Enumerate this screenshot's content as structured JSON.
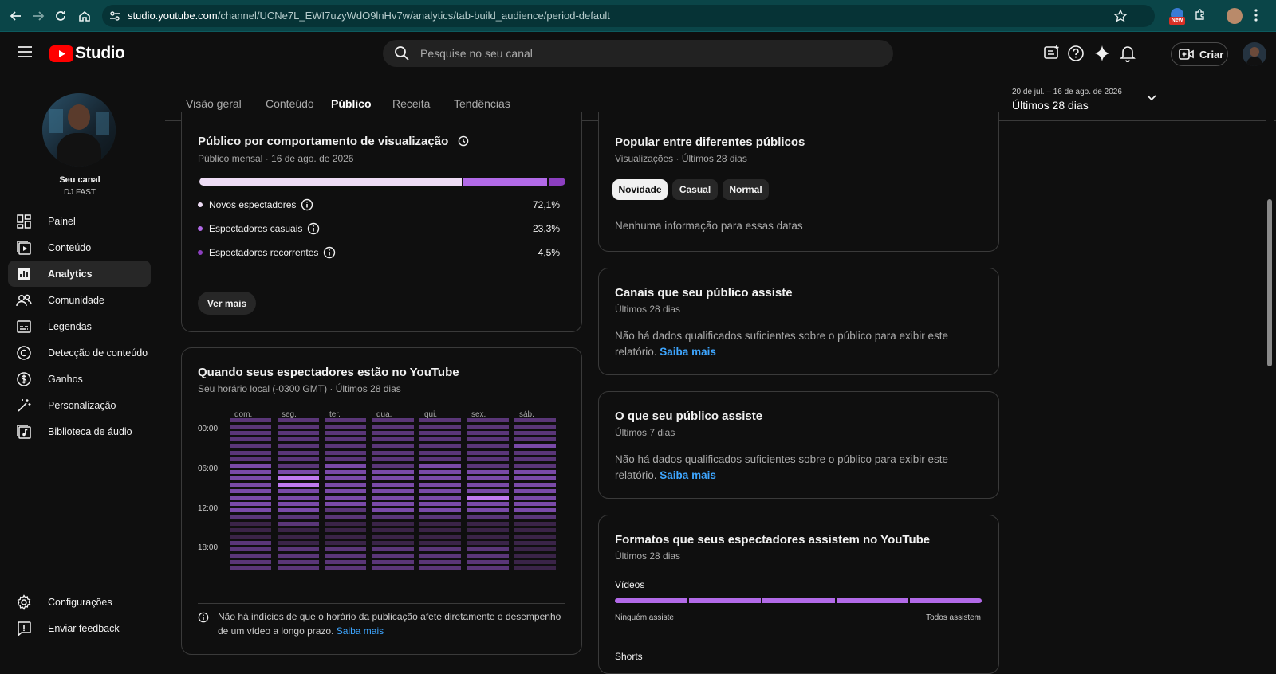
{
  "browser": {
    "url_host": "studio.youtube.com",
    "url_path": "/channel/UCNe7L_EWI7uzyWdO9lnHv7w/analytics/tab-build_audience/period-default",
    "ext_badge": "New"
  },
  "header": {
    "app_name": "Studio",
    "search_placeholder": "Pesquise no seu canal",
    "create_label": "Criar"
  },
  "sidebar": {
    "channel_label": "Seu canal",
    "channel_name": "DJ FAST",
    "items": [
      {
        "label": "Painel",
        "icon": "dashboard-icon"
      },
      {
        "label": "Conteúdo",
        "icon": "content-icon"
      },
      {
        "label": "Analytics",
        "icon": "analytics-icon",
        "active": true
      },
      {
        "label": "Comunidade",
        "icon": "community-icon"
      },
      {
        "label": "Legendas",
        "icon": "subtitles-icon"
      },
      {
        "label": "Detecção de conteúdo",
        "icon": "copyright-icon"
      },
      {
        "label": "Ganhos",
        "icon": "earn-icon"
      },
      {
        "label": "Personalização",
        "icon": "customization-icon"
      },
      {
        "label": "Biblioteca de áudio",
        "icon": "audio-library-icon"
      }
    ],
    "bottom_items": [
      {
        "label": "Configurações",
        "icon": "settings-icon"
      },
      {
        "label": "Enviar feedback",
        "icon": "feedback-icon"
      }
    ]
  },
  "tabs": [
    {
      "label": "Visão geral"
    },
    {
      "label": "Conteúdo"
    },
    {
      "label": "Público",
      "active": true
    },
    {
      "label": "Receita"
    },
    {
      "label": "Tendências"
    }
  ],
  "period": {
    "range": "20 de jul. – 16 de ago. de 2026",
    "label": "Últimos 28 dias"
  },
  "behavior_card": {
    "title": "Público por comportamento de visualização",
    "subtitle": "Público mensal · 16 de ago. de 2026",
    "segments": [
      {
        "label": "Novos espectadores",
        "value": "72,1%",
        "share": 72.1,
        "color": "#eedcf5"
      },
      {
        "label": "Espectadores casuais",
        "value": "23,3%",
        "share": 23.3,
        "color": "#b26ae8"
      },
      {
        "label": "Espectadores recorrentes",
        "value": "4,5%",
        "share": 4.5,
        "color": "#8c3fc0"
      }
    ],
    "more_button": "Ver mais"
  },
  "when_card": {
    "title": "Quando seus espectadores estão no YouTube",
    "subtitle": "Seu horário local (-0300 GMT) · Últimos 28 dias",
    "days": [
      "dom.",
      "seg.",
      "ter.",
      "qua.",
      "qui.",
      "sex.",
      "sáb."
    ],
    "hours": [
      "00:00",
      "06:00",
      "12:00",
      "18:00"
    ],
    "note": "Não há indícios de que o horário da publicação afete diretamente o desempenho de um vídeo a longo prazo.",
    "note_link": "Saiba mais"
  },
  "popular_card": {
    "title": "Popular entre diferentes públicos",
    "subtitle": "Visualizações · Últimos 28 dias",
    "chips": [
      {
        "label": "Novidade",
        "active": true
      },
      {
        "label": "Casual"
      },
      {
        "label": "Normal"
      }
    ],
    "empty": "Nenhuma informação para essas datas"
  },
  "channels_card": {
    "title": "Canais que seu público assiste",
    "subtitle": "Últimos 28 dias",
    "body": "Não há dados qualificados suficientes sobre o público para exibir este relatório.",
    "link": "Saiba mais"
  },
  "watches_card": {
    "title": "O que seu público assiste",
    "subtitle": "Últimos 7 dias",
    "body": "Não há dados qualificados suficientes sobre o público para exibir este relatório.",
    "link": "Saiba mais"
  },
  "formats_card": {
    "title": "Formatos que seus espectadores assistem no YouTube",
    "subtitle": "Últimos 28 dias",
    "video_label": "Vídeos",
    "scale_min": "Ninguém assiste",
    "scale_max": "Todos assistem",
    "shorts_label": "Shorts"
  },
  "colors": {
    "accent": "#b26ae8",
    "link": "#3ea6ff",
    "logo_red": "#ff0000"
  }
}
